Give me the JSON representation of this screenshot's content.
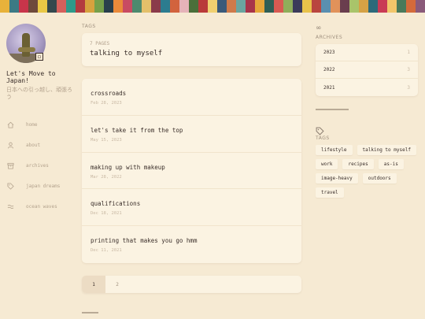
{
  "stripe_colors": [
    "#e8b23a",
    "#3c7a84",
    "#c8354a",
    "#6f4a3c",
    "#e9c845",
    "#34484d",
    "#d5605b",
    "#2e9a8a",
    "#b33b3f",
    "#d7a23e",
    "#76a04a",
    "#283f4c",
    "#ea8a3a",
    "#c84b62",
    "#4d8a6e",
    "#e3c06a",
    "#8a3b4a",
    "#2c7c8f",
    "#d2633d",
    "#e5b3b8",
    "#4a6f3a",
    "#b93a3a",
    "#f0d070",
    "#3a5a7a",
    "#cf7a4a",
    "#6aa5a0",
    "#a8344a",
    "#e6a63a",
    "#2f5f55",
    "#d85a52",
    "#8fae5a",
    "#3b3b5a",
    "#e8c24a",
    "#b9463f",
    "#5a8fb0",
    "#e1925a",
    "#6a3e4e",
    "#a9c46a",
    "#d5a245",
    "#2d6a7a",
    "#c93b55",
    "#f2c66a",
    "#4a7a5a",
    "#d46a3a",
    "#8a5a7a"
  ],
  "blog": {
    "title": "Let's Move to Japan!",
    "description": "日本への引っ越し、頑張ろう"
  },
  "nav": [
    {
      "label": "home",
      "icon": "home-icon"
    },
    {
      "label": "about",
      "icon": "user-icon"
    },
    {
      "label": "archives",
      "icon": "archive-box-icon"
    },
    {
      "label": "japan dreams",
      "icon": "tag-icon"
    },
    {
      "label": "ocean waves",
      "icon": "waves-icon"
    }
  ],
  "main": {
    "section_label": "TAGS",
    "post_count": "7 PAGES",
    "tag_title": "talking to myself",
    "posts": [
      {
        "title": "crossroads",
        "date": "Feb 28, 2023"
      },
      {
        "title": "let's take it from the top",
        "date": "May 15, 2023"
      },
      {
        "title": "making up with makeup",
        "date": "Mar 28, 2022"
      },
      {
        "title": "qualifications",
        "date": "Dec 18, 2021"
      },
      {
        "title": "printing that makes you go hmm",
        "date": "Dec 11, 2021"
      }
    ],
    "pages": [
      "1",
      "2"
    ]
  },
  "sidebar": {
    "archives_label": "ARCHIVES",
    "archives": [
      {
        "year": "2023",
        "count": "1"
      },
      {
        "year": "2022",
        "count": "3"
      },
      {
        "year": "2021",
        "count": "3"
      }
    ],
    "tags_label": "TAGS",
    "tags": [
      [
        "lifestyle",
        "talking to myself"
      ],
      [
        "work",
        "recipes",
        "as-is"
      ],
      [
        "image-heavy",
        "outdoors"
      ],
      [
        "travel"
      ]
    ]
  }
}
